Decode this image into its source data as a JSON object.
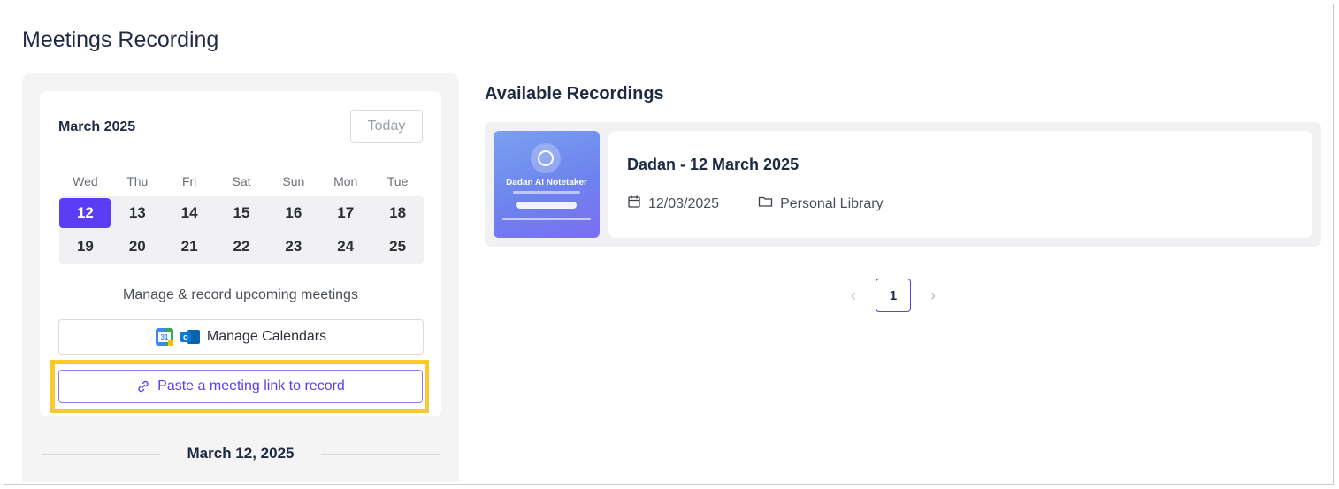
{
  "page": {
    "title": "Meetings Recording"
  },
  "calendar": {
    "month_label": "March 2025",
    "today_label": "Today",
    "weekdays": [
      "Wed",
      "Thu",
      "Fri",
      "Sat",
      "Sun",
      "Mon",
      "Tue"
    ],
    "week1": [
      "12",
      "13",
      "14",
      "15",
      "16",
      "17",
      "18"
    ],
    "week2": [
      "19",
      "20",
      "21",
      "22",
      "23",
      "24",
      "25"
    ],
    "selected_day": "12",
    "upcoming_text": "Manage & record upcoming meetings",
    "manage_calendars_label": "Manage Calendars",
    "google_calendar_icon_text": "31",
    "outlook_icon_text": "o",
    "paste_link_label": "Paste a meeting link to record",
    "selected_date_label": "March 12, 2025"
  },
  "recordings": {
    "section_title": "Available Recordings",
    "items": [
      {
        "thumbnail_title": "Dadan AI Notetaker",
        "title": "Dadan - 12 March 2025",
        "date": "12/03/2025",
        "library": "Personal Library"
      }
    ]
  },
  "pagination": {
    "prev_symbol": "‹",
    "current_page": "1",
    "next_symbol": "›"
  },
  "colors": {
    "accent": "#5b3df5",
    "highlight": "#f9c92e",
    "panel_bg": "#f4f4f5"
  }
}
